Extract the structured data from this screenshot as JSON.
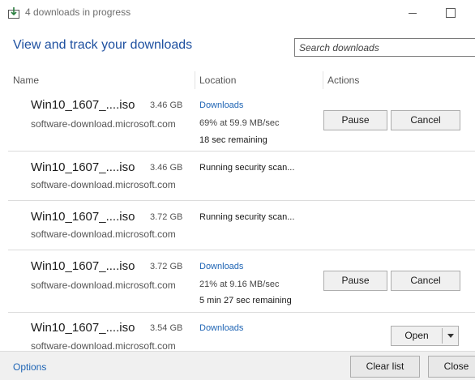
{
  "window": {
    "title": "4 downloads in progress"
  },
  "header": {
    "title": "View and track your downloads",
    "search_placeholder": "Search downloads"
  },
  "columns": {
    "name": "Name",
    "location": "Location",
    "actions": "Actions"
  },
  "downloads": [
    {
      "name": "Win10_1607_....iso",
      "size": "3.46 GB",
      "source": "software-download.microsoft.com",
      "location": "Downloads",
      "status": "69% at 59.9 MB/sec",
      "remaining": "18 sec remaining",
      "pause_label": "Pause",
      "cancel_label": "Cancel"
    },
    {
      "name": "Win10_1607_....iso",
      "size": "3.46 GB",
      "source": "software-download.microsoft.com",
      "status": "Running security scan..."
    },
    {
      "name": "Win10_1607_....iso",
      "size": "3.72 GB",
      "source": "software-download.microsoft.com",
      "status": "Running security scan..."
    },
    {
      "name": "Win10_1607_....iso",
      "size": "3.72 GB",
      "source": "software-download.microsoft.com",
      "location": "Downloads",
      "status": "21% at 9.16 MB/sec",
      "remaining": "5 min 27 sec remaining",
      "pause_label": "Pause",
      "cancel_label": "Cancel"
    },
    {
      "name": "Win10_1607_....iso",
      "size": "3.54 GB",
      "source": "software-download.microsoft.com",
      "location": "Downloads",
      "open_label": "Open"
    }
  ],
  "footer": {
    "options": "Options",
    "clear_list": "Clear list",
    "close": "Close"
  }
}
